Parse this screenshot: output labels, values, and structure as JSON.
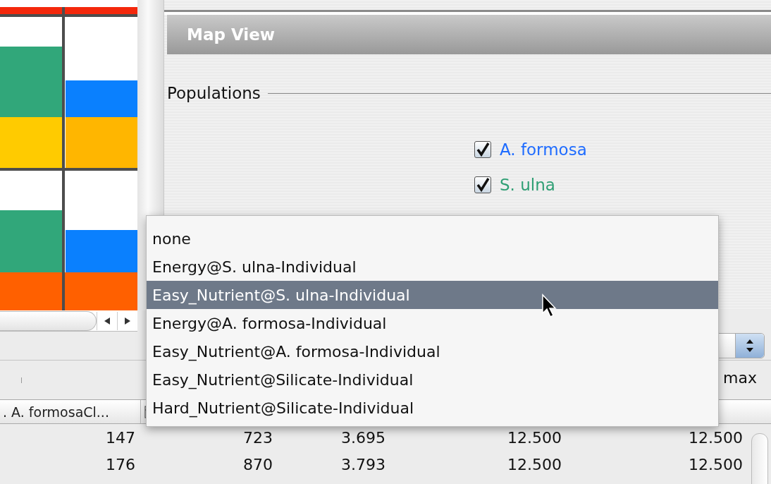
{
  "map_view": {
    "title": "Map View",
    "group_label": "Populations",
    "populations": [
      {
        "label": "A. formosa",
        "checked": true,
        "disabled": false,
        "color": "#1f6cff"
      },
      {
        "label": "S. ulna",
        "checked": true,
        "disabled": false,
        "color": "#2f9f74"
      }
    ]
  },
  "legend": {
    "max_label": "max"
  },
  "table": {
    "columns": [
      {
        "label": ". A. formosaCl..."
      }
    ],
    "rows": [
      [
        "147",
        "723",
        "3.695",
        "12.500",
        "12.500"
      ],
      [
        "176",
        "870",
        "3.793",
        "12.500",
        "12.500"
      ]
    ]
  },
  "menu": {
    "items": [
      {
        "label": "none",
        "selected": false
      },
      {
        "label": "Energy@S. ulna-Individual",
        "selected": false
      },
      {
        "label": "Easy_Nutrient@S. ulna-Individual",
        "selected": true
      },
      {
        "label": "Energy@A. formosa-Individual",
        "selected": false
      },
      {
        "label": "Easy_Nutrient@A. formosa-Individual",
        "selected": false
      },
      {
        "label": "Easy_Nutrient@Silicate-Individual",
        "selected": false
      },
      {
        "label": "Hard_Nutrient@Silicate-Individual",
        "selected": false
      }
    ]
  }
}
